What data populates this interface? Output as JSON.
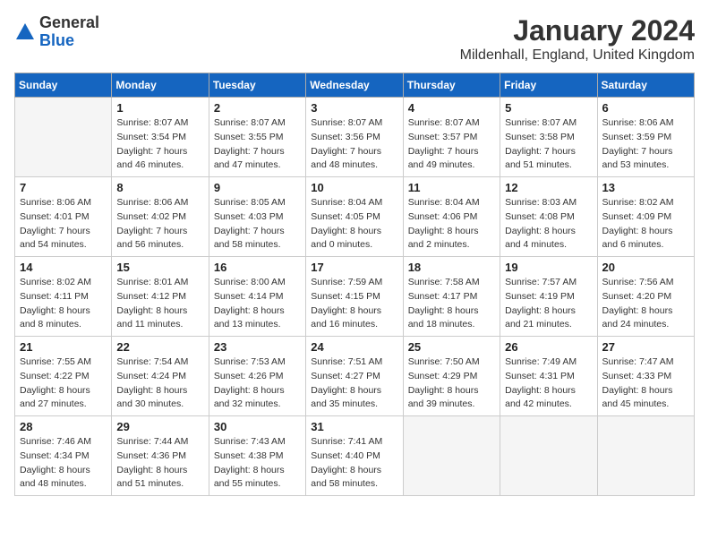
{
  "logo": {
    "general": "General",
    "blue": "Blue"
  },
  "header": {
    "month": "January 2024",
    "location": "Mildenhall, England, United Kingdom"
  },
  "weekdays": [
    "Sunday",
    "Monday",
    "Tuesday",
    "Wednesday",
    "Thursday",
    "Friday",
    "Saturday"
  ],
  "weeks": [
    [
      {
        "day": "",
        "sunrise": "",
        "sunset": "",
        "daylight": ""
      },
      {
        "day": "1",
        "sunrise": "Sunrise: 8:07 AM",
        "sunset": "Sunset: 3:54 PM",
        "daylight": "Daylight: 7 hours and 46 minutes."
      },
      {
        "day": "2",
        "sunrise": "Sunrise: 8:07 AM",
        "sunset": "Sunset: 3:55 PM",
        "daylight": "Daylight: 7 hours and 47 minutes."
      },
      {
        "day": "3",
        "sunrise": "Sunrise: 8:07 AM",
        "sunset": "Sunset: 3:56 PM",
        "daylight": "Daylight: 7 hours and 48 minutes."
      },
      {
        "day": "4",
        "sunrise": "Sunrise: 8:07 AM",
        "sunset": "Sunset: 3:57 PM",
        "daylight": "Daylight: 7 hours and 49 minutes."
      },
      {
        "day": "5",
        "sunrise": "Sunrise: 8:07 AM",
        "sunset": "Sunset: 3:58 PM",
        "daylight": "Daylight: 7 hours and 51 minutes."
      },
      {
        "day": "6",
        "sunrise": "Sunrise: 8:06 AM",
        "sunset": "Sunset: 3:59 PM",
        "daylight": "Daylight: 7 hours and 53 minutes."
      }
    ],
    [
      {
        "day": "7",
        "sunrise": "Sunrise: 8:06 AM",
        "sunset": "Sunset: 4:01 PM",
        "daylight": "Daylight: 7 hours and 54 minutes."
      },
      {
        "day": "8",
        "sunrise": "Sunrise: 8:06 AM",
        "sunset": "Sunset: 4:02 PM",
        "daylight": "Daylight: 7 hours and 56 minutes."
      },
      {
        "day": "9",
        "sunrise": "Sunrise: 8:05 AM",
        "sunset": "Sunset: 4:03 PM",
        "daylight": "Daylight: 7 hours and 58 minutes."
      },
      {
        "day": "10",
        "sunrise": "Sunrise: 8:04 AM",
        "sunset": "Sunset: 4:05 PM",
        "daylight": "Daylight: 8 hours and 0 minutes."
      },
      {
        "day": "11",
        "sunrise": "Sunrise: 8:04 AM",
        "sunset": "Sunset: 4:06 PM",
        "daylight": "Daylight: 8 hours and 2 minutes."
      },
      {
        "day": "12",
        "sunrise": "Sunrise: 8:03 AM",
        "sunset": "Sunset: 4:08 PM",
        "daylight": "Daylight: 8 hours and 4 minutes."
      },
      {
        "day": "13",
        "sunrise": "Sunrise: 8:02 AM",
        "sunset": "Sunset: 4:09 PM",
        "daylight": "Daylight: 8 hours and 6 minutes."
      }
    ],
    [
      {
        "day": "14",
        "sunrise": "Sunrise: 8:02 AM",
        "sunset": "Sunset: 4:11 PM",
        "daylight": "Daylight: 8 hours and 8 minutes."
      },
      {
        "day": "15",
        "sunrise": "Sunrise: 8:01 AM",
        "sunset": "Sunset: 4:12 PM",
        "daylight": "Daylight: 8 hours and 11 minutes."
      },
      {
        "day": "16",
        "sunrise": "Sunrise: 8:00 AM",
        "sunset": "Sunset: 4:14 PM",
        "daylight": "Daylight: 8 hours and 13 minutes."
      },
      {
        "day": "17",
        "sunrise": "Sunrise: 7:59 AM",
        "sunset": "Sunset: 4:15 PM",
        "daylight": "Daylight: 8 hours and 16 minutes."
      },
      {
        "day": "18",
        "sunrise": "Sunrise: 7:58 AM",
        "sunset": "Sunset: 4:17 PM",
        "daylight": "Daylight: 8 hours and 18 minutes."
      },
      {
        "day": "19",
        "sunrise": "Sunrise: 7:57 AM",
        "sunset": "Sunset: 4:19 PM",
        "daylight": "Daylight: 8 hours and 21 minutes."
      },
      {
        "day": "20",
        "sunrise": "Sunrise: 7:56 AM",
        "sunset": "Sunset: 4:20 PM",
        "daylight": "Daylight: 8 hours and 24 minutes."
      }
    ],
    [
      {
        "day": "21",
        "sunrise": "Sunrise: 7:55 AM",
        "sunset": "Sunset: 4:22 PM",
        "daylight": "Daylight: 8 hours and 27 minutes."
      },
      {
        "day": "22",
        "sunrise": "Sunrise: 7:54 AM",
        "sunset": "Sunset: 4:24 PM",
        "daylight": "Daylight: 8 hours and 30 minutes."
      },
      {
        "day": "23",
        "sunrise": "Sunrise: 7:53 AM",
        "sunset": "Sunset: 4:26 PM",
        "daylight": "Daylight: 8 hours and 32 minutes."
      },
      {
        "day": "24",
        "sunrise": "Sunrise: 7:51 AM",
        "sunset": "Sunset: 4:27 PM",
        "daylight": "Daylight: 8 hours and 35 minutes."
      },
      {
        "day": "25",
        "sunrise": "Sunrise: 7:50 AM",
        "sunset": "Sunset: 4:29 PM",
        "daylight": "Daylight: 8 hours and 39 minutes."
      },
      {
        "day": "26",
        "sunrise": "Sunrise: 7:49 AM",
        "sunset": "Sunset: 4:31 PM",
        "daylight": "Daylight: 8 hours and 42 minutes."
      },
      {
        "day": "27",
        "sunrise": "Sunrise: 7:47 AM",
        "sunset": "Sunset: 4:33 PM",
        "daylight": "Daylight: 8 hours and 45 minutes."
      }
    ],
    [
      {
        "day": "28",
        "sunrise": "Sunrise: 7:46 AM",
        "sunset": "Sunset: 4:34 PM",
        "daylight": "Daylight: 8 hours and 48 minutes."
      },
      {
        "day": "29",
        "sunrise": "Sunrise: 7:44 AM",
        "sunset": "Sunset: 4:36 PM",
        "daylight": "Daylight: 8 hours and 51 minutes."
      },
      {
        "day": "30",
        "sunrise": "Sunrise: 7:43 AM",
        "sunset": "Sunset: 4:38 PM",
        "daylight": "Daylight: 8 hours and 55 minutes."
      },
      {
        "day": "31",
        "sunrise": "Sunrise: 7:41 AM",
        "sunset": "Sunset: 4:40 PM",
        "daylight": "Daylight: 8 hours and 58 minutes."
      },
      {
        "day": "",
        "sunrise": "",
        "sunset": "",
        "daylight": ""
      },
      {
        "day": "",
        "sunrise": "",
        "sunset": "",
        "daylight": ""
      },
      {
        "day": "",
        "sunrise": "",
        "sunset": "",
        "daylight": ""
      }
    ]
  ]
}
